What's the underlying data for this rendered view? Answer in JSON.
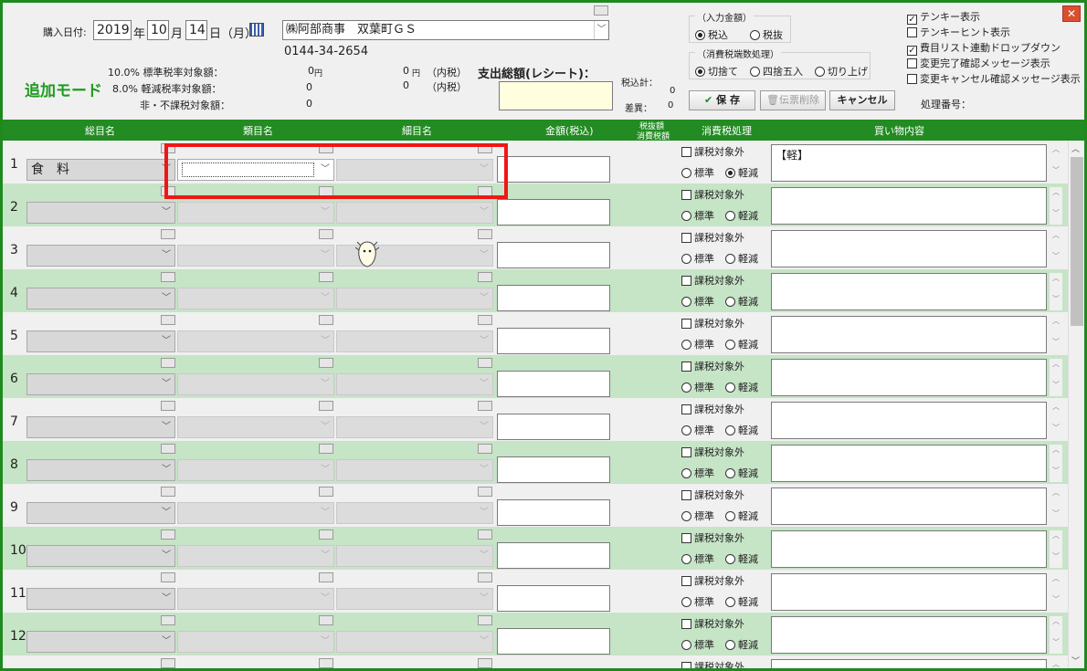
{
  "header": {
    "purchase_date_label": "購入日付:",
    "year": "2019",
    "year_unit": "年",
    "month": "10",
    "month_unit": "月",
    "day": "14",
    "day_unit": "日（月）",
    "store": "㈱阿部商事　双葉町ＧＳ",
    "phone": "0144-34-2654",
    "mode": "追加モード",
    "tax_rows": [
      {
        "label": "10.0% 標準税率対象額：",
        "amount": "0",
        "unit": "円",
        "amount2": "0",
        "unit2": "円",
        "note": "（内税）"
      },
      {
        "label": "8.0% 軽減税率対象額：",
        "amount": "0",
        "unit": "",
        "amount2": "0",
        "unit2": "",
        "note": "（内税）"
      },
      {
        "label": "非・不課税対象額：",
        "amount": "0",
        "unit": "",
        "amount2": "",
        "unit2": "",
        "note": ""
      }
    ],
    "total_label": "支出総額(レシート)：",
    "tax_incl_total_label": "税込計：",
    "tax_incl_total_value": "0",
    "diff_label": "差異：",
    "diff_value": "0",
    "input_amount_group": "（入力金額）",
    "input_incl": "税込",
    "input_excl": "税抜",
    "rounding_group": "（消費税端数処理）",
    "round_down": "切捨て",
    "round_half": "四捨五入",
    "round_up": "切り上げ",
    "save": "保 存",
    "delete": "伝票削除",
    "cancel": "キャンセル",
    "opt_tenkey": "テンキー表示",
    "opt_tenkey_hint": "テンキーヒント表示",
    "opt_dropdown": "費目リスト連動ドロップダウン",
    "opt_confirm_done": "変更完了確認メッセージ表示",
    "opt_confirm_cancel": "変更キャンセル確認メッセージ表示",
    "process_no_label": "処理番号：",
    "close": "✕"
  },
  "columns": {
    "major": "総目名",
    "category": "類目名",
    "detail": "細目名",
    "amount": "金額(税込)",
    "tax_excl": "税抜額",
    "tax_amt": "消費税額",
    "tax_proc": "消費税処理",
    "content": "買い物内容"
  },
  "row_labels": {
    "exempt": "課税対象外",
    "standard": "標準",
    "reduced": "軽減"
  },
  "rows": [
    {
      "num": "1",
      "major": "食　料",
      "memo": "【軽】"
    },
    {
      "num": "2",
      "major": "",
      "memo": ""
    },
    {
      "num": "3",
      "major": "",
      "memo": ""
    },
    {
      "num": "4",
      "major": "",
      "memo": ""
    },
    {
      "num": "5",
      "major": "",
      "memo": ""
    },
    {
      "num": "6",
      "major": "",
      "memo": ""
    },
    {
      "num": "7",
      "major": "",
      "memo": ""
    },
    {
      "num": "8",
      "major": "",
      "memo": ""
    },
    {
      "num": "9",
      "major": "",
      "memo": ""
    },
    {
      "num": "10",
      "major": "",
      "memo": ""
    },
    {
      "num": "11",
      "major": "",
      "memo": ""
    },
    {
      "num": "12",
      "major": "",
      "memo": ""
    },
    {
      "num": "",
      "major": "",
      "memo": ""
    }
  ]
}
